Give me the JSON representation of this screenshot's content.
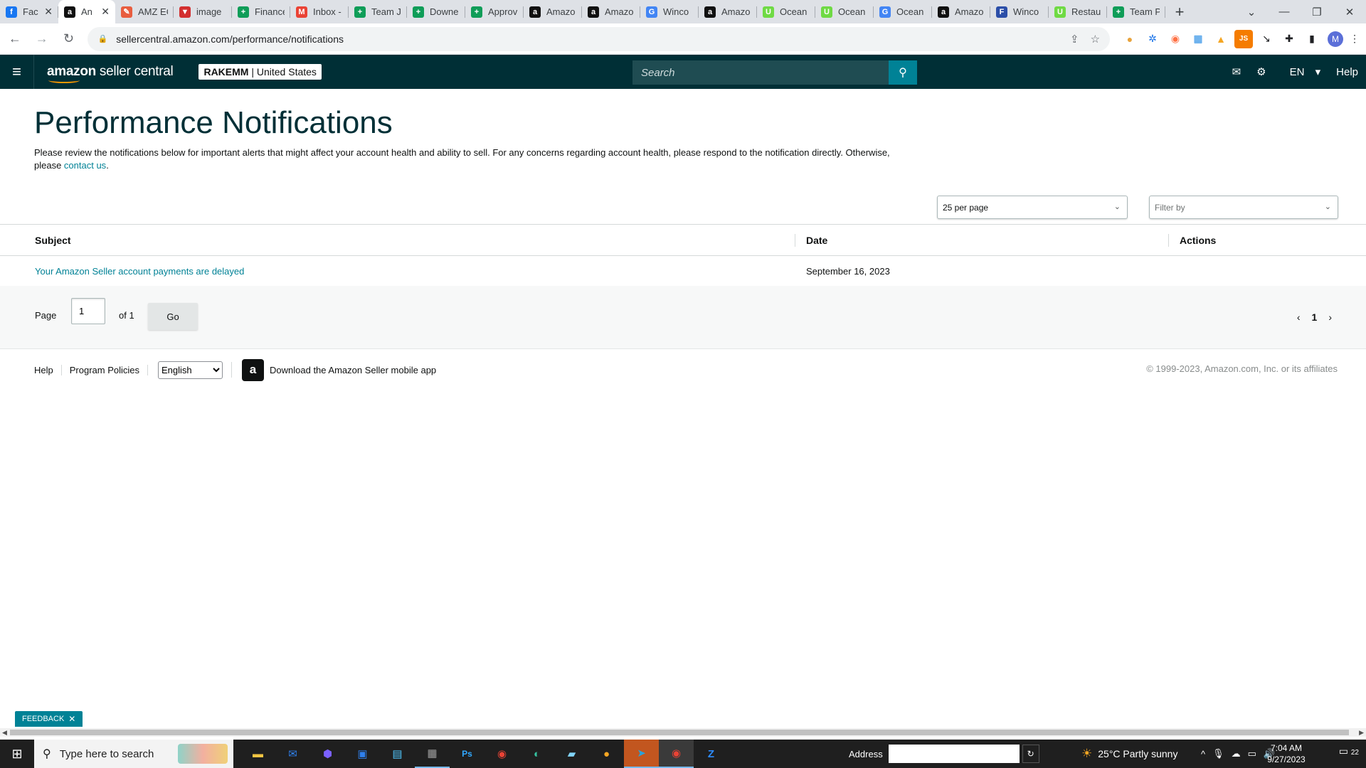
{
  "browser": {
    "tabs": [
      {
        "label": "Fac",
        "icon": "facebook-icon",
        "color": "#1877f2",
        "glyph": "f",
        "active": false
      },
      {
        "label": "An",
        "icon": "amazon-icon",
        "color": "#111111",
        "glyph": "a",
        "active": true
      },
      {
        "label": "AMZ EC",
        "icon": "amz-ec-icon",
        "color": "#e85d3f",
        "glyph": "✎",
        "active": false
      },
      {
        "label": "image",
        "icon": "image-icon",
        "color": "#d32f2f",
        "glyph": "▼",
        "active": false
      },
      {
        "label": "Finance",
        "icon": "sheets-icon",
        "color": "#0f9d58",
        "glyph": "+",
        "active": false
      },
      {
        "label": "Inbox -",
        "icon": "gmail-icon",
        "color": "#ea4335",
        "glyph": "M",
        "active": false
      },
      {
        "label": "Team Jo",
        "icon": "sheets-icon",
        "color": "#0f9d58",
        "glyph": "+",
        "active": false
      },
      {
        "label": "Downe",
        "icon": "sheets-icon",
        "color": "#0f9d58",
        "glyph": "+",
        "active": false
      },
      {
        "label": "Approv",
        "icon": "sheets-icon",
        "color": "#0f9d58",
        "glyph": "+",
        "active": false
      },
      {
        "label": "Amazo",
        "icon": "amazon-icon",
        "color": "#111111",
        "glyph": "a",
        "active": false
      },
      {
        "label": "Amazo",
        "icon": "amazon-icon",
        "color": "#111111",
        "glyph": "a",
        "active": false
      },
      {
        "label": "Winco",
        "icon": "google-icon",
        "color": "#4285f4",
        "glyph": "G",
        "active": false
      },
      {
        "label": "Amazo",
        "icon": "amazon-icon",
        "color": "#111111",
        "glyph": "a",
        "active": false
      },
      {
        "label": "Ocean",
        "icon": "upwork-icon",
        "color": "#6fda44",
        "glyph": "U",
        "active": false
      },
      {
        "label": "Ocean",
        "icon": "upwork-icon",
        "color": "#6fda44",
        "glyph": "U",
        "active": false
      },
      {
        "label": "Ocean",
        "icon": "google-icon",
        "color": "#4285f4",
        "glyph": "G",
        "active": false
      },
      {
        "label": "Amazo",
        "icon": "amazon-icon",
        "color": "#111111",
        "glyph": "a",
        "active": false
      },
      {
        "label": "Winco",
        "icon": "fs-icon",
        "color": "#2b4ea8",
        "glyph": "F",
        "active": false
      },
      {
        "label": "Restau",
        "icon": "upwork-icon",
        "color": "#6fda44",
        "glyph": "U",
        "active": false
      },
      {
        "label": "Team P",
        "icon": "sheets-icon",
        "color": "#0f9d58",
        "glyph": "+",
        "active": false
      }
    ],
    "url": "sellercentral.amazon.com/performance/notifications",
    "profile_initial": "M"
  },
  "header": {
    "logo_bold": "amazon",
    "logo_light": " seller central",
    "account": "RAKEMM",
    "marketplace": "United States",
    "search_placeholder": "Search",
    "language": "EN",
    "help": "Help"
  },
  "page": {
    "title": "Performance Notifications",
    "intro": "Please review the notifications below for important alerts that might affect your account health and ability to sell. For any concerns regarding account health, please respond to the notification directly. Otherwise, please ",
    "contact_link": "contact us",
    "intro_end": ".",
    "per_page": "25 per page",
    "filter_placeholder": "Filter by"
  },
  "table": {
    "headers": {
      "subject": "Subject",
      "date": "Date",
      "actions": "Actions"
    },
    "rows": [
      {
        "subject": "Your Amazon Seller account payments are delayed",
        "date": "September 16, 2023",
        "actions": ""
      }
    ]
  },
  "pagination": {
    "page_label": "Page",
    "current": "1",
    "of_label": "of 1",
    "go": "Go",
    "current_page_number": "1"
  },
  "footer": {
    "help": "Help",
    "policies": "Program Policies",
    "language": "English",
    "app_text": "Download the Amazon Seller mobile app",
    "copyright": "© 1999-2023, Amazon.com, Inc. or its affiliates"
  },
  "feedback": "FEEDBACK",
  "taskbar": {
    "search_placeholder": "Type here to search",
    "address_label": "Address",
    "weather": "25°C  Partly sunny",
    "time": "7:04 AM",
    "date": "9/27/2023",
    "notifications": "22"
  },
  "colors": {
    "header_bg": "#002f36",
    "accent": "#008296",
    "title": "#002f36"
  }
}
